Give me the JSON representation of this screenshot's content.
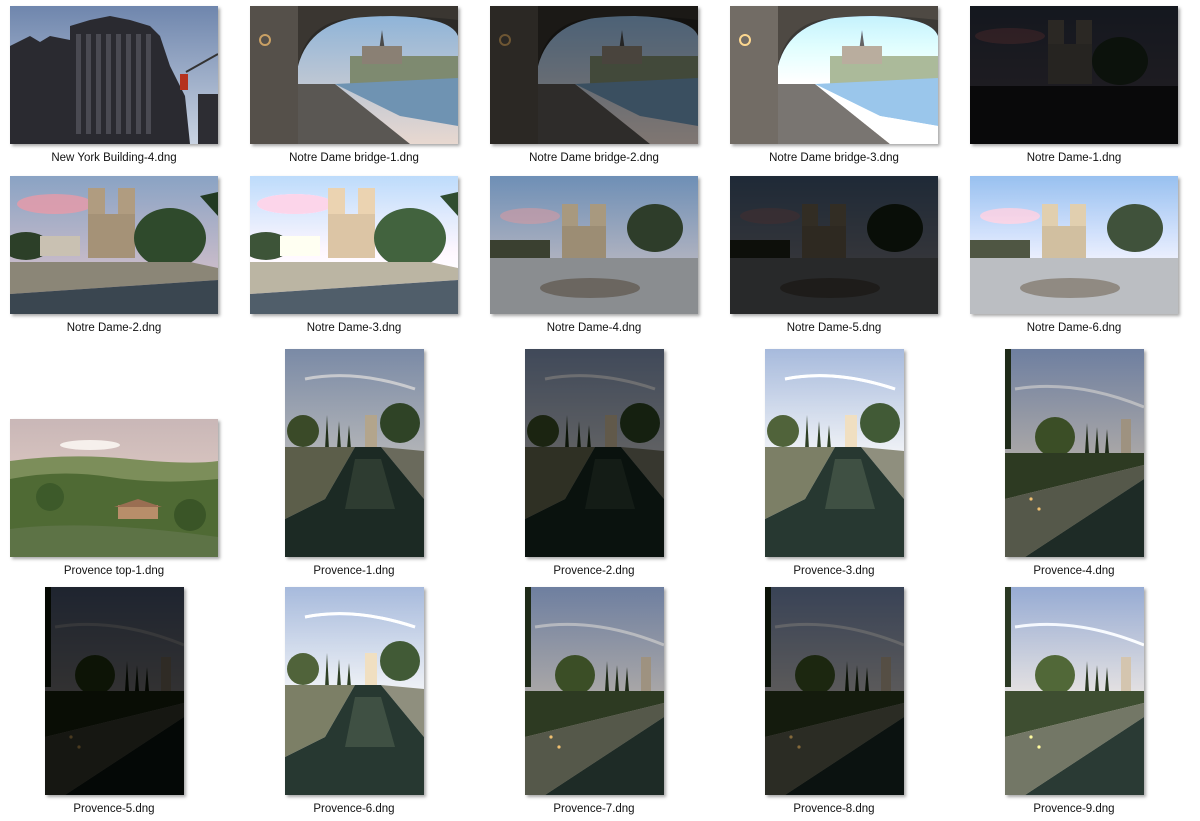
{
  "files": [
    {
      "name": "New York Building-4.dng",
      "scene": "ny-building",
      "exposure": "normal"
    },
    {
      "name": "Notre Dame bridge-1.dng",
      "scene": "bridge",
      "exposure": "normal"
    },
    {
      "name": "Notre Dame bridge-2.dng",
      "scene": "bridge",
      "exposure": "dark"
    },
    {
      "name": "Notre Dame bridge-3.dng",
      "scene": "bridge",
      "exposure": "bright"
    },
    {
      "name": "Notre Dame-1.dng",
      "scene": "notre-dame-night",
      "exposure": "dark"
    },
    {
      "name": "Notre Dame-2.dng",
      "scene": "notre-dame-river",
      "exposure": "normal"
    },
    {
      "name": "Notre Dame-3.dng",
      "scene": "notre-dame-river",
      "exposure": "bright"
    },
    {
      "name": "Notre Dame-4.dng",
      "scene": "notre-dame-square",
      "exposure": "normal"
    },
    {
      "name": "Notre Dame-5.dng",
      "scene": "notre-dame-square",
      "exposure": "very-dark"
    },
    {
      "name": "Notre Dame-6.dng",
      "scene": "notre-dame-square",
      "exposure": "bright"
    },
    {
      "name": "Provence top-1.dng",
      "scene": "provence-landscape",
      "exposure": "normal"
    },
    {
      "name": "Provence-1.dng",
      "scene": "provence-canal",
      "exposure": "normal"
    },
    {
      "name": "Provence-2.dng",
      "scene": "provence-canal",
      "exposure": "dark"
    },
    {
      "name": "Provence-3.dng",
      "scene": "provence-canal",
      "exposure": "bright"
    },
    {
      "name": "Provence-4.dng",
      "scene": "provence-canal-b",
      "exposure": "normal"
    },
    {
      "name": "Provence-5.dng",
      "scene": "provence-canal-b",
      "exposure": "very-dark"
    },
    {
      "name": "Provence-6.dng",
      "scene": "provence-canal",
      "exposure": "bright"
    },
    {
      "name": "Provence-7.dng",
      "scene": "provence-canal-b",
      "exposure": "normal"
    },
    {
      "name": "Provence-8.dng",
      "scene": "provence-canal-b",
      "exposure": "dark"
    },
    {
      "name": "Provence-9.dng",
      "scene": "provence-canal-b",
      "exposure": "bright"
    }
  ]
}
